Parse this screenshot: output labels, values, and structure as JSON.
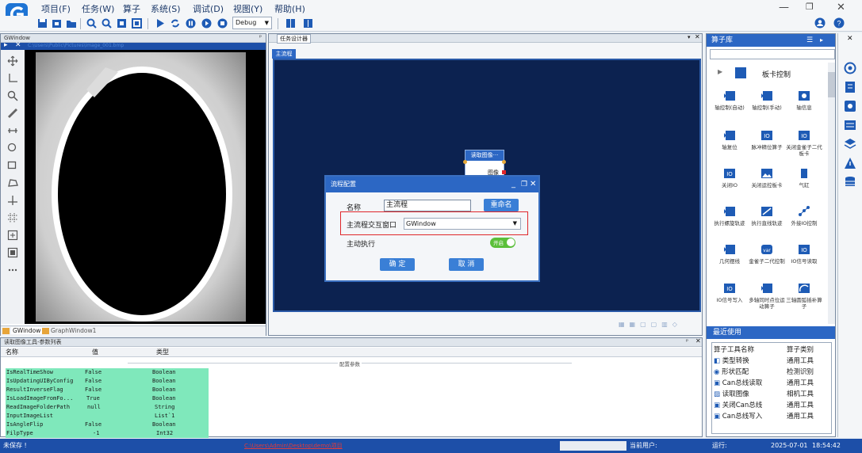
{
  "menu": [
    "项目(F)",
    "任务(W)",
    "算子",
    "系统(S)",
    "调试(D)",
    "视图(Y)",
    "帮助(H)"
  ],
  "toolbar": {
    "mode": "Debug"
  },
  "gwindow": {
    "title": "GWindow",
    "path": "C:\\Users\\Public\\Pictures\\image_001.bmp",
    "tabs": [
      "GWindow",
      "GraphWindow1"
    ]
  },
  "task": {
    "tab": "任务设计器",
    "flow_tab": "主流程"
  },
  "node": {
    "title": "读取图像···",
    "port": "图像"
  },
  "dialog": {
    "title": "流程配置",
    "name_label": "名称",
    "name_value": "主流程",
    "rename": "重命名",
    "window_label": "主流程交互窗口",
    "window_value": "GWindow",
    "auto_label": "主动执行",
    "toggle": "开启",
    "ok": "确 定",
    "cancel": "取 消"
  },
  "library": {
    "title": "算子库",
    "category": "板卡控制",
    "operators": [
      "轴控制(自动)",
      "轴控制(手动)",
      "轴信息",
      "轴复位",
      "脉冲精位算子",
      "关闭金雀子二代板卡",
      "关闭IO",
      "关闭运控板卡",
      "气缸",
      "执行螺旋轨迹",
      "执行直线轨迹",
      "外接IO控制",
      "几何摆线",
      "金雀子二代控制",
      "IO信号读取",
      "IO信号写入",
      "多轴同时点位运动算子",
      "三轴圆弧插补算子"
    ]
  },
  "recent": {
    "title": "最近使用",
    "headers": [
      "算子工具名称",
      "算子类别"
    ],
    "rows": [
      [
        "类型转换",
        "通用工具"
      ],
      [
        "形状匹配",
        "检测识别"
      ],
      [
        "Can总线读取",
        "通用工具"
      ],
      [
        "读取图像",
        "相机工具"
      ],
      [
        "关闭Can总线",
        "通用工具"
      ],
      [
        "Can总线写入",
        "通用工具"
      ]
    ]
  },
  "params": {
    "title": "读取图像工具-参数列表",
    "headers": [
      "名称",
      "值",
      "类型"
    ],
    "section": "配置参数",
    "rows": [
      [
        "IsRealTimeShow",
        "False",
        "Boolean"
      ],
      [
        "IsUpdatingUIByConfig",
        "False",
        "Boolean"
      ],
      [
        "ResultInverseFlag",
        "False",
        "Boolean"
      ],
      [
        "IsLoadImageFromFo...",
        "True",
        "Boolean"
      ],
      [
        "ReadImageFolderPath",
        "null",
        "String"
      ],
      [
        "InputImageList",
        "",
        "List`1"
      ],
      [
        "IsAngleFlip",
        "False",
        "Boolean"
      ],
      [
        "FilpType",
        "-1",
        "Int32"
      ]
    ]
  },
  "status": {
    "save": "未保存 !",
    "path": "C:\\Users\\Admin\\Desktop\\demo\\项目",
    "user": "当前用户:",
    "run": "运行:",
    "date": "2025-07-01",
    "time": "18:54:42"
  },
  "colors": {
    "accent": "#2c67c4",
    "status": "#1d4fa8",
    "canvas": "#0c2250",
    "highlight": "#e0262a",
    "param_row": "#7fe8bb"
  }
}
